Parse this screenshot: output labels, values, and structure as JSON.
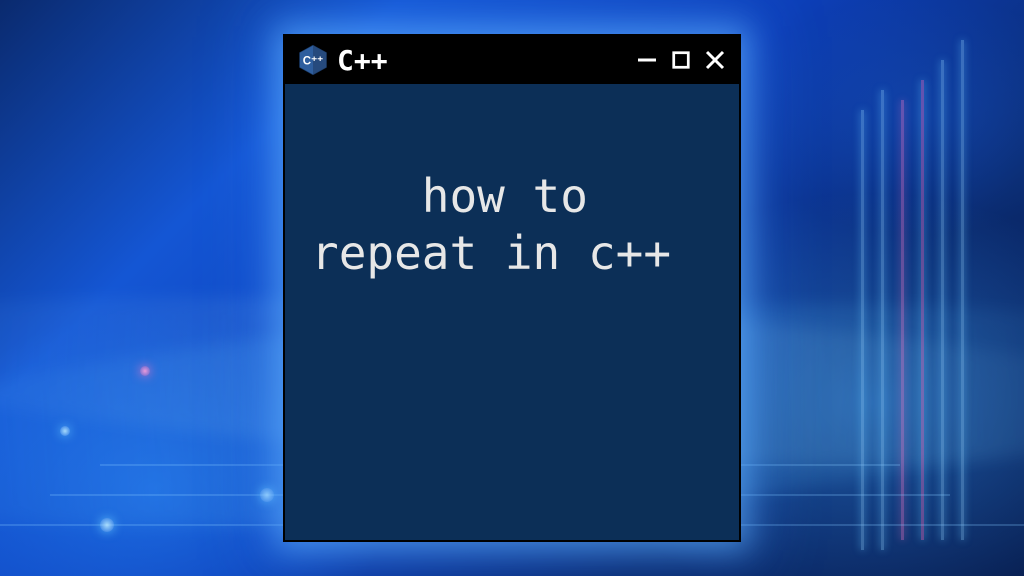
{
  "window": {
    "title": "C++",
    "icon": "cpp-hex-icon",
    "controls": {
      "minimize": "−",
      "maximize": "□",
      "close": "×"
    }
  },
  "content": {
    "body_text": "how to repeat in c++"
  },
  "colors": {
    "window_bg": "#0c2f57",
    "titlebar_bg": "#000000",
    "text": "#e7e7e7",
    "glow": "#5cb4ff"
  }
}
